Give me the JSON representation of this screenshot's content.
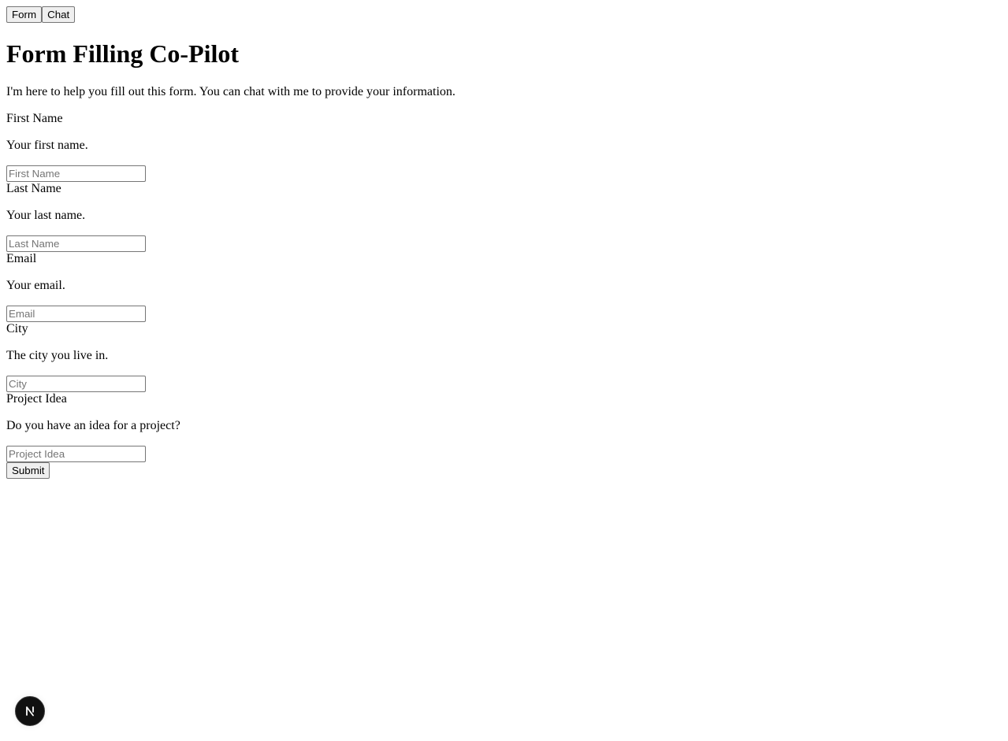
{
  "tabs": [
    {
      "label": "Form"
    },
    {
      "label": "Chat"
    }
  ],
  "page": {
    "title": "Form Filling Co-Pilot",
    "intro": "I'm here to help you fill out this form. You can chat with me to provide your information."
  },
  "fields": [
    {
      "label": "First Name",
      "description": "Your first name.",
      "placeholder": "First Name",
      "value": ""
    },
    {
      "label": "Last Name",
      "description": "Your last name.",
      "placeholder": "Last Name",
      "value": ""
    },
    {
      "label": "Email",
      "description": "Your email.",
      "placeholder": "Email",
      "value": ""
    },
    {
      "label": "City",
      "description": "The city you live in.",
      "placeholder": "City",
      "value": ""
    },
    {
      "label": "Project Idea",
      "description": "Do you have an idea for a project?",
      "placeholder": "Project Idea",
      "value": ""
    }
  ],
  "actions": {
    "submit_label": "Submit"
  },
  "dev_badge": {
    "icon": "nextjs-logo-icon",
    "color": "#111111"
  }
}
